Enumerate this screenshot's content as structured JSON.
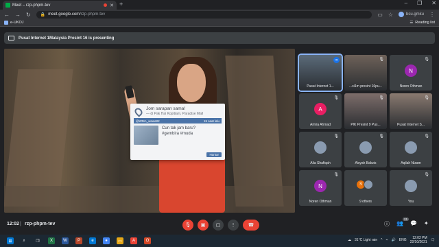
{
  "browser": {
    "tab_title": "Meet – rzp-phpm-tev",
    "new_tab": "+",
    "window_controls": [
      "–",
      "❐",
      "✕"
    ],
    "url_host": "meet.google.com",
    "url_path": "/rzp-phpm-tev",
    "profile_name": "bsu.gmku",
    "bookmark": "e-UKOJ",
    "reading_list": "Reading list"
  },
  "meet": {
    "banner_text": "Pusat Internet 1Malaysia Presint 16 is presenting",
    "time": "12:02",
    "meeting_code": "rzp-phpm-tev",
    "participant_badge": "21"
  },
  "slide": {
    "location_title": "Jom sarapan sama!",
    "location_sub": "— di Pak Hai Kopitiam, Paradise Mall",
    "user_handle": "@WMA_wawa02",
    "post_time": "15 saat lalu",
    "post_text_1": "Cun tak jam baru?",
    "post_text_2": "#gembira #muda",
    "send_label": "Hantar"
  },
  "participants": [
    {
      "name": "Pusat Internet 1...",
      "type": "video",
      "active": true,
      "talking": true
    },
    {
      "name": "...si1m presint 16pu...",
      "type": "video"
    },
    {
      "name": "Noren Othman",
      "type": "initial",
      "initial": "N",
      "color": "#9c27b0"
    },
    {
      "name": "Amira Ahmad",
      "type": "initial",
      "initial": "A",
      "color": "#e91e63"
    },
    {
      "name": "PIK Presint 9 Pus...",
      "type": "video"
    },
    {
      "name": "Pusat Internet S...",
      "type": "video"
    },
    {
      "name": "Alia Shafiqah",
      "type": "photo"
    },
    {
      "name": "Aisyah Bakzis",
      "type": "photo"
    },
    {
      "name": "Aqilah Nizam",
      "type": "photo"
    },
    {
      "name": "Noren Othman",
      "type": "initial",
      "initial": "N",
      "color": "#9c27b0"
    },
    {
      "name": "9 others",
      "type": "others"
    },
    {
      "name": "You",
      "type": "photo"
    }
  ],
  "others_initial": "S",
  "taskbar": {
    "weather": "31°C Light rain",
    "lang": "ENG",
    "clock_time": "12:02 PM",
    "clock_date": "22/10/2021"
  },
  "colors": {
    "accent": "#8ab4f8",
    "hangup": "#ea4335",
    "surface": "#3c4043"
  }
}
